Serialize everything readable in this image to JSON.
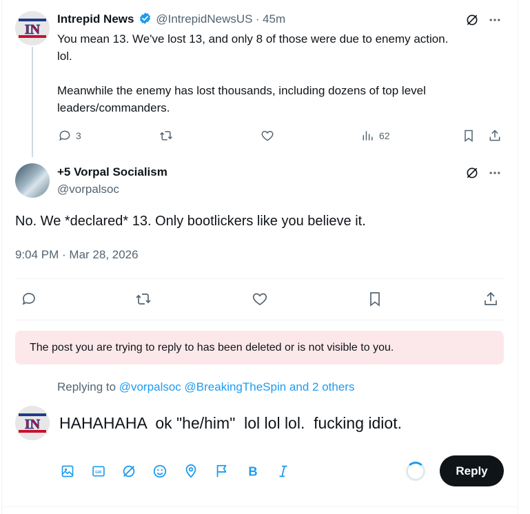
{
  "parent_tweet": {
    "display_name": "Intrepid News",
    "handle": "@IntrepidNewsUS",
    "separator": "·",
    "time_ago": "45m",
    "avatar_text": "IN",
    "body_line1": "You mean 13.  We've lost 13, and only 8 of those were due to enemy action.",
    "body_line2": "lol.",
    "body_line3": "Meanwhile the enemy has lost thousands, including dozens of top level",
    "body_line4": "leaders/commanders.",
    "reply_count": "3",
    "views_count": "62",
    "verified_color": "#1d9bf0"
  },
  "main_tweet": {
    "display_name": "+5 Vorpal Socialism",
    "handle": "@vorpalsoc",
    "body": "No. We *declared* 13. Only bootlickers like you believe it.",
    "timestamp": "9:04 PM · Mar 28, 2026"
  },
  "notice": {
    "text": "The post you are trying to reply to has been deleted or is not visible to you."
  },
  "replying": {
    "prefix": "Replying to",
    "mentions": "@vorpalsoc @BreakingTheSpin and 2 others"
  },
  "composer": {
    "text": "HAHAHAHA  ok \"he/him\"  lol lol lol.  fucking idiot.",
    "avatar_text": "IN",
    "reply_label": "Reply",
    "toolbar_icons": [
      "image-icon",
      "gif-icon",
      "grok-icon",
      "emoji-icon",
      "location-icon",
      "flag-icon",
      "bold-icon",
      "italic-icon"
    ]
  },
  "colors": {
    "accent": "#1d9bf0",
    "muted": "#536471",
    "notice_bg": "#fce8ea"
  }
}
